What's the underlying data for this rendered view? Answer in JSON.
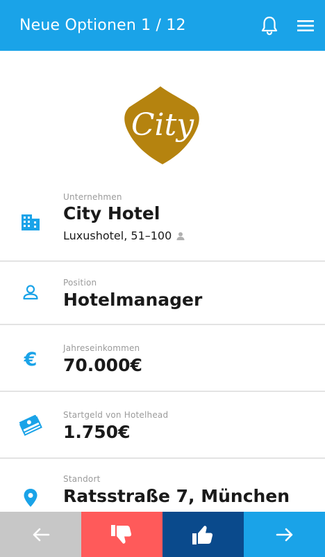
{
  "header": {
    "title": "Neue Optionen 1 / 12",
    "accent_color": "#1aa3e8",
    "icons": [
      "bell-icon",
      "hamburger-menu-icon"
    ]
  },
  "logo": {
    "text": "City",
    "color": "#b5830f"
  },
  "company": {
    "label": "Unternehmen",
    "name": "City Hotel",
    "details": "Luxushotel, 51–100",
    "icon": "building-icon"
  },
  "position": {
    "label": "Position",
    "value": "Hotelmanager",
    "icon": "person-icon"
  },
  "salary": {
    "label": "Jahreseinkommen",
    "value": "70.000€",
    "icon": "euro-icon"
  },
  "bonus": {
    "label": "Startgeld von Hotelhead",
    "value": "1.750€",
    "icon": "money-icon"
  },
  "location": {
    "label": "Standort",
    "value": "Ratsstraße 7, München",
    "icon": "location-pin-icon"
  },
  "bottom_bar": {
    "buttons": [
      "back-arrow",
      "thumbs-down",
      "thumbs-up",
      "next-arrow"
    ],
    "colors": [
      "#c7c7c7",
      "#ff5a5a",
      "#0a4a8c",
      "#1aa3e8"
    ]
  }
}
